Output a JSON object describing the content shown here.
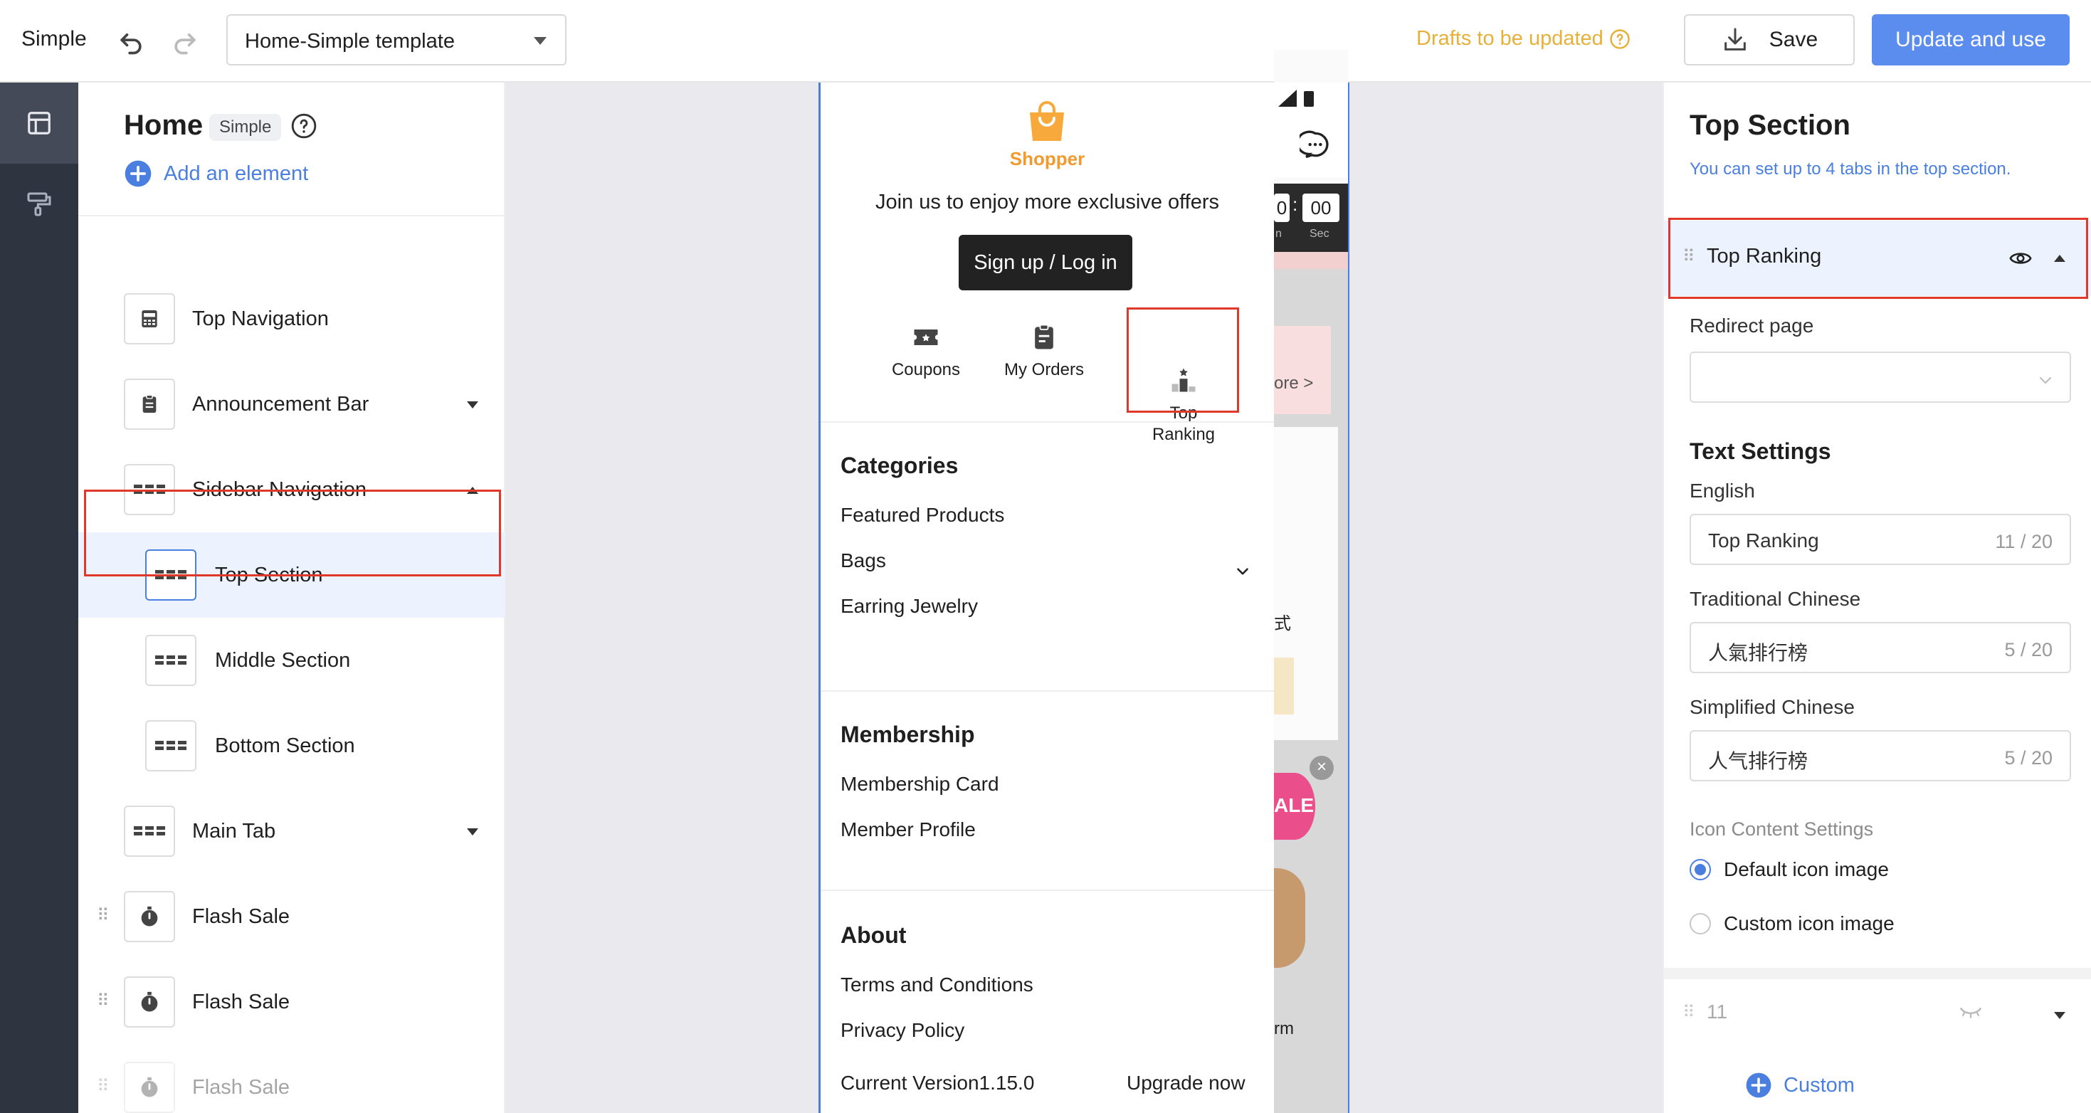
{
  "topbar": {
    "app_title": "Simple",
    "template": "Home-Simple template",
    "drafts": "Drafts to be updated",
    "save_label": "Save",
    "update_label": "Update and use"
  },
  "panel": {
    "title": "Home",
    "badge": "Simple",
    "add_element": "Add an element",
    "items": [
      {
        "label": "Top Navigation",
        "icon": "navbar-icon"
      },
      {
        "label": "Announcement Bar",
        "icon": "clipboard-icon"
      },
      {
        "label": "Sidebar Navigation",
        "icon": "grid-icon"
      },
      {
        "label": "Top Section",
        "icon": "grid-icon"
      },
      {
        "label": "Middle Section",
        "icon": "grid-icon"
      },
      {
        "label": "Bottom Section",
        "icon": "grid-icon"
      },
      {
        "label": "Main Tab",
        "icon": "grid-icon"
      },
      {
        "label": "Flash Sale",
        "icon": "stopwatch-icon"
      },
      {
        "label": "Flash Sale",
        "icon": "stopwatch-icon"
      },
      {
        "label": "Flash Sale",
        "icon": "stopwatch-icon"
      }
    ]
  },
  "drawer": {
    "shop_name": "Shopper",
    "join_text": "Join us to enjoy more exclusive offers",
    "signup_label": "Sign up / Log in",
    "quick": [
      {
        "label": "Coupons",
        "icon": "coupon-icon"
      },
      {
        "label": "My Orders",
        "icon": "orders-icon"
      },
      {
        "label": "Top\nRanking",
        "icon": "podium-icon"
      }
    ],
    "categories_title": "Categories",
    "categories": [
      "Featured Products",
      "Bags",
      "Earring Jewelry"
    ],
    "membership_title": "Membership",
    "membership": [
      "Membership Card",
      "Member Profile"
    ],
    "about_title": "About",
    "about": [
      "Terms and Conditions",
      "Privacy Policy"
    ],
    "version": "Current Version1.15.0",
    "upgrade": "Upgrade now"
  },
  "peek": {
    "time_left": "0",
    "time_right": "00",
    "time_sub_left": "n",
    "time_sub_right": "Sec",
    "more": "ore >",
    "sale": "ALE",
    "char": "式",
    "farm": "rm"
  },
  "settings": {
    "title": "Top Section",
    "subtitle": "You can set up to 4 tabs in the top section.",
    "tab1_label": "Top Ranking",
    "redirect_label": "Redirect page",
    "redirect_value": "",
    "text_settings": "Text Settings",
    "fields": [
      {
        "label": "English",
        "value": "Top Ranking",
        "count": "11 / 20"
      },
      {
        "label": "Traditional Chinese",
        "value": "人氣排行榜",
        "count": "5 / 20"
      },
      {
        "label": "Simplified Chinese",
        "value": "人气排行榜",
        "count": "5 / 20"
      }
    ],
    "icon_settings": "Icon Content Settings",
    "radio_default": "Default icon image",
    "radio_custom": "Custom icon image",
    "tab2_label": "11",
    "custom_label": "Custom"
  },
  "colors": {
    "accent": "#5b8def",
    "highlight_box": "#e0392b",
    "warning": "#e6b13a",
    "brand": "#f29a2e"
  }
}
